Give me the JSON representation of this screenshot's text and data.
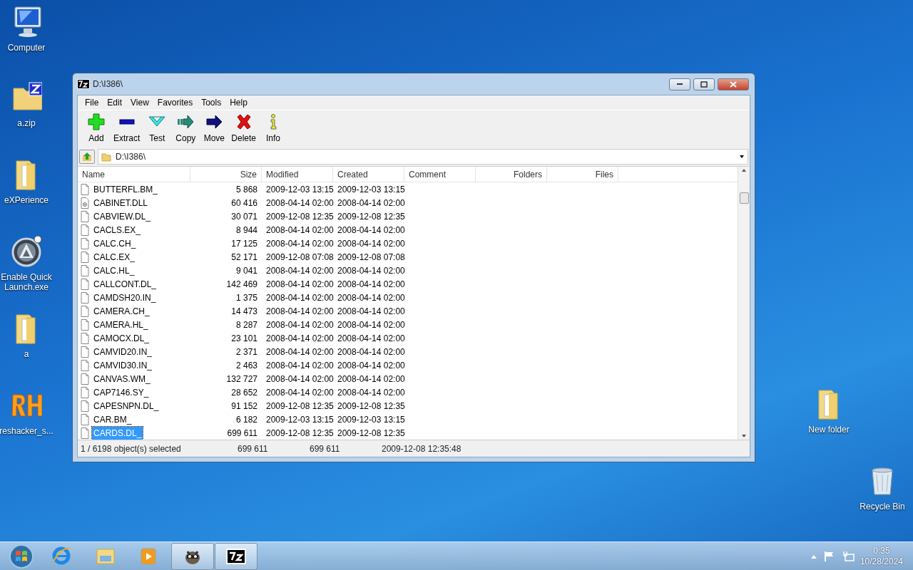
{
  "desktop_icons": [
    {
      "label": "Computer",
      "kind": "computer"
    },
    {
      "label": "a.zip",
      "kind": "zip"
    },
    {
      "label": "eXPerience",
      "kind": "folder"
    },
    {
      "label": "Enable Quick Launch.exe",
      "kind": "exe"
    },
    {
      "label": "a",
      "kind": "folder"
    },
    {
      "label": "reshacker_s...",
      "kind": "rh"
    },
    {
      "label": "New folder",
      "kind": "folder"
    },
    {
      "label": "Recycle Bin",
      "kind": "bin"
    }
  ],
  "window": {
    "title": "D:\\I386\\",
    "menu": [
      "File",
      "Edit",
      "View",
      "Favorites",
      "Tools",
      "Help"
    ],
    "toolbar": [
      {
        "label": "Add",
        "kind": "add"
      },
      {
        "label": "Extract",
        "kind": "extract"
      },
      {
        "label": "Test",
        "kind": "test"
      },
      {
        "label": "Copy",
        "kind": "copy"
      },
      {
        "label": "Move",
        "kind": "move"
      },
      {
        "label": "Delete",
        "kind": "delete"
      },
      {
        "label": "Info",
        "kind": "info"
      }
    ],
    "address": "D:\\I386\\",
    "columns": [
      "Name",
      "Size",
      "Modified",
      "Created",
      "Comment",
      "Folders",
      "Files"
    ],
    "rows": [
      {
        "name": "BUTTERFL.BM_",
        "size": "5 868",
        "modified": "2009-12-03 13:15",
        "created": "2009-12-03 13:15",
        "kind": "file",
        "selected": false
      },
      {
        "name": "CABINET.DLL",
        "size": "60 416",
        "modified": "2008-04-14 02:00",
        "created": "2008-04-14 02:00",
        "kind": "dll",
        "selected": false
      },
      {
        "name": "CABVIEW.DL_",
        "size": "30 071",
        "modified": "2009-12-08 12:35",
        "created": "2009-12-08 12:35",
        "kind": "file",
        "selected": false
      },
      {
        "name": "CACLS.EX_",
        "size": "8 944",
        "modified": "2008-04-14 02:00",
        "created": "2008-04-14 02:00",
        "kind": "file",
        "selected": false
      },
      {
        "name": "CALC.CH_",
        "size": "17 125",
        "modified": "2008-04-14 02:00",
        "created": "2008-04-14 02:00",
        "kind": "file",
        "selected": false
      },
      {
        "name": "CALC.EX_",
        "size": "52 171",
        "modified": "2009-12-08 07:08",
        "created": "2009-12-08 07:08",
        "kind": "file",
        "selected": false
      },
      {
        "name": "CALC.HL_",
        "size": "9 041",
        "modified": "2008-04-14 02:00",
        "created": "2008-04-14 02:00",
        "kind": "file",
        "selected": false
      },
      {
        "name": "CALLCONT.DL_",
        "size": "142 469",
        "modified": "2008-04-14 02:00",
        "created": "2008-04-14 02:00",
        "kind": "file",
        "selected": false
      },
      {
        "name": "CAMDSH20.IN_",
        "size": "1 375",
        "modified": "2008-04-14 02:00",
        "created": "2008-04-14 02:00",
        "kind": "file",
        "selected": false
      },
      {
        "name": "CAMERA.CH_",
        "size": "14 473",
        "modified": "2008-04-14 02:00",
        "created": "2008-04-14 02:00",
        "kind": "file",
        "selected": false
      },
      {
        "name": "CAMERA.HL_",
        "size": "8 287",
        "modified": "2008-04-14 02:00",
        "created": "2008-04-14 02:00",
        "kind": "file",
        "selected": false
      },
      {
        "name": "CAMOCX.DL_",
        "size": "23 101",
        "modified": "2008-04-14 02:00",
        "created": "2008-04-14 02:00",
        "kind": "file",
        "selected": false
      },
      {
        "name": "CAMVID20.IN_",
        "size": "2 371",
        "modified": "2008-04-14 02:00",
        "created": "2008-04-14 02:00",
        "kind": "file",
        "selected": false
      },
      {
        "name": "CAMVID30.IN_",
        "size": "2 463",
        "modified": "2008-04-14 02:00",
        "created": "2008-04-14 02:00",
        "kind": "file",
        "selected": false
      },
      {
        "name": "CANVAS.WM_",
        "size": "132 727",
        "modified": "2008-04-14 02:00",
        "created": "2008-04-14 02:00",
        "kind": "file",
        "selected": false
      },
      {
        "name": "CAP7146.SY_",
        "size": "28 652",
        "modified": "2008-04-14 02:00",
        "created": "2008-04-14 02:00",
        "kind": "file",
        "selected": false
      },
      {
        "name": "CAPESNPN.DL_",
        "size": "91 152",
        "modified": "2009-12-08 12:35",
        "created": "2009-12-08 12:35",
        "kind": "file",
        "selected": false
      },
      {
        "name": "CAR.BM_",
        "size": "6 182",
        "modified": "2009-12-03 13:15",
        "created": "2009-12-03 13:15",
        "kind": "file",
        "selected": false
      },
      {
        "name": "CARDS.DL_",
        "size": "699 611",
        "modified": "2009-12-08 12:35",
        "created": "2009-12-08 12:35",
        "kind": "file",
        "selected": true
      }
    ],
    "status_bar": [
      "1 / 6198 object(s) selected",
      "699 611",
      "699 611",
      "2009-12-08 12:35:48"
    ]
  },
  "taskbar": {
    "items": [
      {
        "kind": "ie",
        "running": false
      },
      {
        "kind": "explorer",
        "running": false
      },
      {
        "kind": "media",
        "running": false
      },
      {
        "kind": "raccoon",
        "running": true
      },
      {
        "kind": "archiver",
        "running": true
      }
    ],
    "clock": {
      "time": "0:35",
      "date": "10/28/2024"
    }
  }
}
